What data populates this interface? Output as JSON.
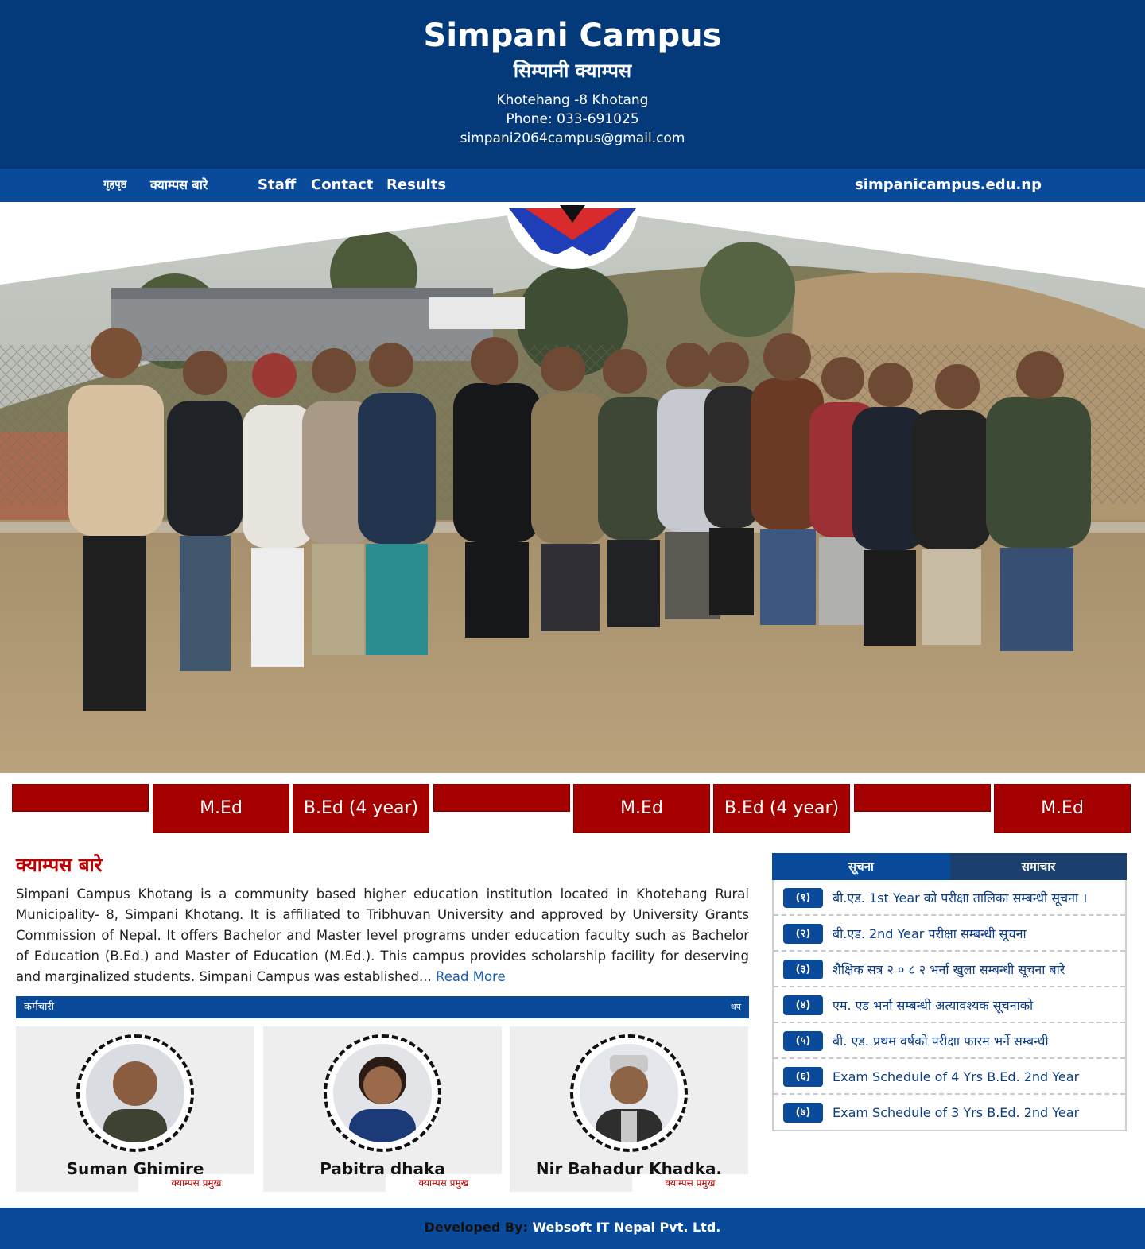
{
  "header": {
    "title": "Simpani Campus",
    "subtitle": "सिम्पानी क्याम्पस",
    "address": "Khotehang -8 Khotang",
    "phone": "Phone: 033-691025",
    "email": "simpani2064campus@gmail.com"
  },
  "nav": {
    "items": [
      {
        "label": "गृहपृष्ठ"
      },
      {
        "label": "क्याम्पस बारे"
      },
      {
        "label": "Staff"
      },
      {
        "label": "Contact"
      },
      {
        "label": "Results"
      }
    ],
    "domain": "simpanicampus.edu.np"
  },
  "programs": [
    {
      "label": ""
    },
    {
      "label": "M.Ed"
    },
    {
      "label": "B.Ed (4 year)"
    },
    {
      "label": ""
    },
    {
      "label": "M.Ed"
    },
    {
      "label": "B.Ed (4 year)"
    },
    {
      "label": ""
    },
    {
      "label": "M.Ed"
    }
  ],
  "about": {
    "title": "क्याम्पस बारे",
    "text": "Simpani Campus Khotang is a community based higher education institution located in Khotehang Rural Municipality- 8, Simpani Khotang. It is affiliated to Tribhuvan University and approved by University Grants Commission of Nepal. It offers Bachelor and Master level programs under education faculty such as Bachelor of Education (B.Ed.) and Master of Education (M.Ed.). This campus provides scholarship facility for deserving and marginalized students. Simpani Campus was established...",
    "read_more": "Read More"
  },
  "staff": {
    "section_title": "कर्मचारी",
    "more_label": "थप",
    "members": [
      {
        "name": "Suman Ghimire",
        "role": "क्याम्पस प्रमुख"
      },
      {
        "name": "Pabitra dhaka",
        "role": "क्याम्पस प्रमुख"
      },
      {
        "name": "Nir Bahadur Khadka,",
        "role": "क्याम्पस प्रमुख"
      }
    ]
  },
  "notices": {
    "tabs": [
      {
        "label": "सूचना",
        "active": true
      },
      {
        "label": "समाचार",
        "active": false
      }
    ],
    "items": [
      {
        "badge": "(१)",
        "text": "बी.एड. 1st Year को परीक्षा तालिका सम्बन्धी सूचना ।"
      },
      {
        "badge": "(२)",
        "text": "बी.एड. 2nd Year परीक्षा सम्बन्धी सूचना"
      },
      {
        "badge": "(३)",
        "text": "शैक्षिक सत्र २ ० ८ २ भर्ना खुला सम्बन्धी सूचना बारे"
      },
      {
        "badge": "(४)",
        "text": "एम. एड भर्ना सम्बन्धी अत्यावश्यक सूचनाको"
      },
      {
        "badge": "(५)",
        "text": "बी. एड. प्रथम वर्षको परीक्षा फारम भर्ने सम्बन्धी"
      },
      {
        "badge": "(६)",
        "text": "Exam Schedule of 4 Yrs B.Ed. 2nd Year"
      },
      {
        "badge": "(७)",
        "text": "Exam Schedule of 3 Yrs B.Ed. 2nd Year"
      }
    ]
  },
  "footer": {
    "label": "Developed By:",
    "company": "Websoft IT Nepal Pvt. Ltd."
  },
  "colors": {
    "header_bg": "#053a7a",
    "nav_bg": "#0a4a9a",
    "program_bg": "#a50000",
    "about_title": "#c00000",
    "notice_text": "#0b3d86"
  }
}
